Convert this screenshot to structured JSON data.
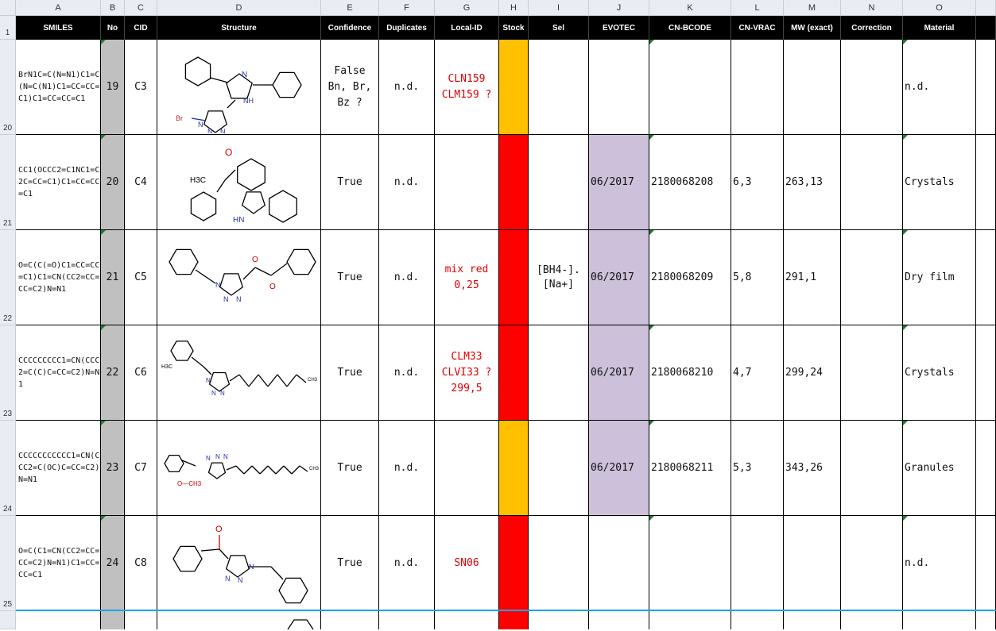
{
  "columns": {
    "A": "A",
    "B": "B",
    "C": "C",
    "D": "D",
    "E": "E",
    "F": "F",
    "G": "G",
    "H": "H",
    "I": "I",
    "J": "J",
    "K": "K",
    "L": "L",
    "M": "M",
    "N": "N",
    "O": "O"
  },
  "headers": {
    "smiles": "SMILES",
    "no": "No",
    "cid": "CID",
    "structure": "Structure",
    "confidence": "Confidence",
    "duplicates": "Duplicates",
    "local_id": "Local-ID",
    "stock": "Stock",
    "sel": "Sel",
    "evotec": "EVOTEC",
    "cn_bcode": "CN-BCODE",
    "cn_vrac": "CN-VRAC",
    "mw": "MW (exact)",
    "correction": "Correction",
    "material": "Material"
  },
  "row_numbers": {
    "h": "1",
    "r20": "20",
    "r21": "21",
    "r22": "22",
    "r23": "23",
    "r24": "24",
    "r25": "25"
  },
  "colors": {
    "stock_orange": "#ffc000",
    "stock_red": "#ff0000",
    "evotec_lavender": "#ccc0da",
    "no_grey": "#c0c0c0",
    "text_red": "#e00000"
  },
  "rows": [
    {
      "smiles": "BrN1C=C(N=N1)C1=C(N=C(N1)C1=CC=CC=C1)C1=CC=CC=C1",
      "no": "19",
      "cid": "C3",
      "confidence": [
        "False",
        "Bn, Br,",
        "Bz ?"
      ],
      "duplicates": "n.d.",
      "local_id": [
        "CLN159",
        "CLM159 ?"
      ],
      "stock": "orange",
      "sel": "",
      "evotec": "",
      "cn_bcode": "",
      "cn_vrac": "",
      "mw": "",
      "correction": "",
      "material": "n.d.",
      "struct_labels": {
        "n1": "N",
        "n2": "NH",
        "br": "Br",
        "n3": "N",
        "n4": "N",
        "n5": "N"
      }
    },
    {
      "smiles": "CC1(OCCC2=C1NC1=C2C=CC=C1)C1=CC=CC=C1",
      "no": "20",
      "cid": "C4",
      "confidence": [
        "True"
      ],
      "duplicates": "n.d.",
      "local_id": [],
      "stock": "red",
      "sel": "",
      "evotec": "06/2017",
      "cn_bcode": "2180068208",
      "cn_vrac": "6,3",
      "mw": "263,13",
      "correction": "",
      "material": "Crystals",
      "struct_labels": {
        "o": "O",
        "me": "H3C",
        "nh": "HN"
      }
    },
    {
      "smiles": "O=C(C(=O)C1=CC=CC=C1)C1=CN(CC2=CC=CC=C2)N=N1",
      "no": "21",
      "cid": "C5",
      "confidence": [
        "True"
      ],
      "duplicates": "n.d.",
      "local_id": [
        "mix red",
        "0,25"
      ],
      "stock": "red",
      "sel": "[BH4-].[Na+]",
      "evotec": "06/2017",
      "cn_bcode": "2180068209",
      "cn_vrac": "5,8",
      "mw": "291,1",
      "correction": "",
      "material": "Dry film",
      "struct_labels": {
        "o1": "O",
        "o2": "O",
        "n1": "N",
        "n2": "N",
        "n3": "N"
      }
    },
    {
      "smiles": "CCCCCCCCC1=CN(CCC2=C(C)C=CC=C2)N=N1",
      "no": "22",
      "cid": "C6",
      "confidence": [
        "True"
      ],
      "duplicates": "n.d.",
      "local_id": [
        "CLM33",
        "CLVI33 ?",
        "299,5"
      ],
      "stock": "red",
      "sel": "",
      "evotec": "06/2017",
      "cn_bcode": "2180068210",
      "cn_vrac": "4,7",
      "mw": "299,24",
      "correction": "",
      "material": "Crystals",
      "struct_labels": {
        "me": "H3C",
        "ch3": "CH3",
        "n1": "N",
        "n2": "N",
        "n3": "N"
      }
    },
    {
      "smiles": "CCCCCCCCCCC1=CN(CCC2=C(OC)C=CC=C2)N=N1",
      "no": "23",
      "cid": "C7",
      "confidence": [
        "True"
      ],
      "duplicates": "n.d.",
      "local_id": [],
      "stock": "orange",
      "sel": "",
      "evotec": "06/2017",
      "cn_bcode": "2180068211",
      "cn_vrac": "5,3",
      "mw": "343,26",
      "correction": "",
      "material": "Granules",
      "struct_labels": {
        "ome": "O—CH3",
        "ch3": "CH3",
        "n1": "N",
        "n2": "N",
        "n3": "N"
      }
    },
    {
      "smiles": "O=C(C1=CN(CC2=CC=CC=C2)N=N1)C1=CC=CC=C1",
      "no": "24",
      "cid": "C8",
      "confidence": [
        "True"
      ],
      "duplicates": "n.d.",
      "local_id": [
        "SN06"
      ],
      "stock": "red",
      "sel": "",
      "evotec": "",
      "cn_bcode": "",
      "cn_vrac": "",
      "mw": "",
      "correction": "",
      "material": "n.d.",
      "struct_labels": {
        "o": "O",
        "n1": "N",
        "n2": "N",
        "n3": "N"
      }
    }
  ]
}
